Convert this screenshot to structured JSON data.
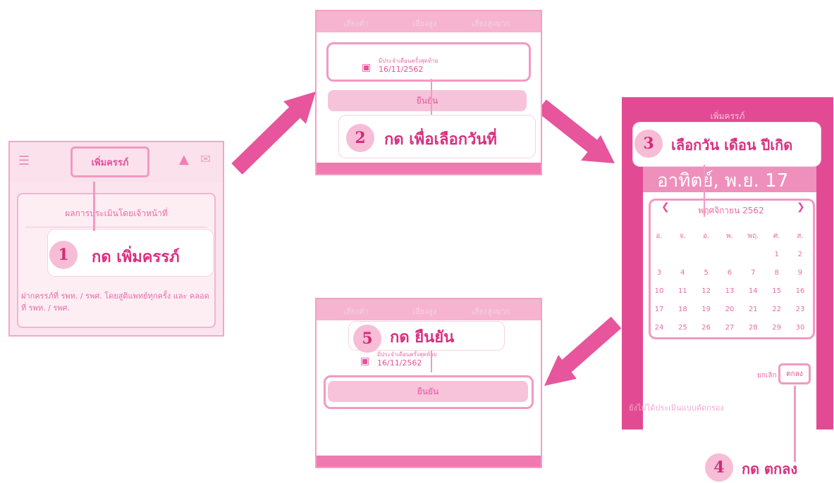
{
  "colors": {
    "accent": "#e24b93",
    "light_pink": "#fce4ef",
    "arrow": "#e7559c"
  },
  "panel1": {
    "title_button": "เพิ่มครรภ์",
    "card_heading": "ผลการประเมินโดยเจ้าหน้าที่",
    "card_footer": "ฝากครรภ์ที่ รพท. / รพศ. โดยสูติแพทย์ทุกครั้ง และ คลอดที่ รพท. / รพศ.",
    "step_number": "1",
    "step_label": "กด เพิ่มครรภ์",
    "icons": [
      "menu-icon",
      "bell-icon",
      "mail-icon"
    ]
  },
  "panel2": {
    "tabs": [
      "เสี่ยงต่ำ",
      "เสี่ยงสูง",
      "เสี่ยงสูงมาก"
    ],
    "field_caption": "มีประจำเดือนครั้งสุดท้าย",
    "field_value": "16/11/2562",
    "confirm_label": "ยืนยัน",
    "step_number": "2",
    "step_label": "กด เพื่อเลือกวันที่"
  },
  "panel3": {
    "header_title": "เพิ่มครรภ์",
    "selected_date": "อาทิตย์, พ.ย. 17",
    "month_label": "พฤศจิกายน 2562",
    "weekdays": [
      "อ.",
      "จ.",
      "อ.",
      "พ.",
      "พฤ.",
      "ศ.",
      "ส."
    ],
    "weeks": [
      [
        "",
        "",
        "",
        "",
        "",
        "1",
        "2"
      ],
      [
        "3",
        "4",
        "5",
        "6",
        "7",
        "8",
        "9"
      ],
      [
        "10",
        "11",
        "12",
        "13",
        "14",
        "15",
        "16"
      ],
      [
        "17",
        "18",
        "19",
        "20",
        "21",
        "22",
        "23"
      ],
      [
        "24",
        "25",
        "26",
        "27",
        "28",
        "29",
        "30"
      ]
    ],
    "cancel_label": "ยกเลิก",
    "ok_label": "ตกลง",
    "footer_text": "ยังไม่ได้ประเมินแบบคัดกรอง",
    "step_number": "3",
    "step_label": "เลือกวัน เดือน ปีเกิด",
    "step4_number": "4",
    "step4_label": "กด ตกลง"
  },
  "panel5": {
    "tabs": [
      "เสี่ยงต่ำ",
      "เสี่ยงสูง",
      "เสี่ยงสูงมาก"
    ],
    "field_caption": "มีประจำเดือนครั้งสุดท้าย",
    "field_value": "16/11/2562",
    "confirm_label": "ยืนยัน",
    "step_number": "5",
    "step_label": "กด ยืนยัน"
  }
}
